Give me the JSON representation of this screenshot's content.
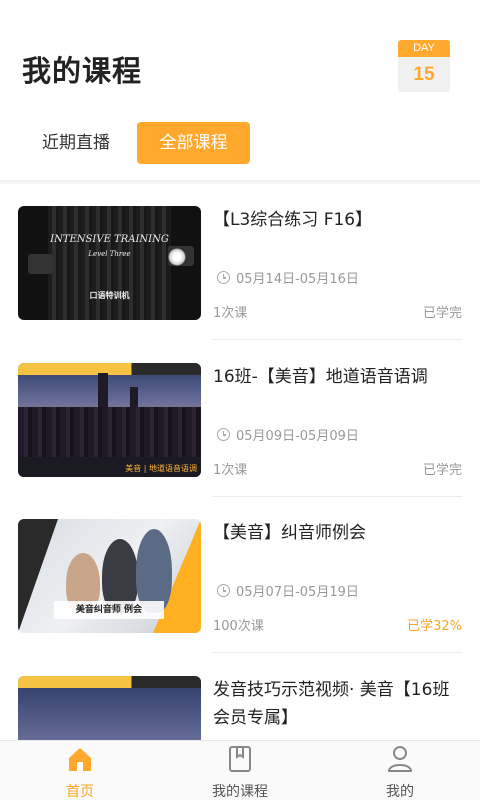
{
  "header": {
    "title": "我的课程",
    "day_label": "DAY",
    "day_number": "15"
  },
  "tabs": [
    {
      "label": "近期直播",
      "active": false
    },
    {
      "label": "全部课程",
      "active": true
    }
  ],
  "courses": [
    {
      "title": "【L3综合练习 F16】",
      "date": "05月14日-05月16日",
      "count": "1次课",
      "status": "已学完",
      "thumb_text": [
        "INTENSIVE TRAINING",
        "Level Three",
        "口语特训机"
      ]
    },
    {
      "title": "16班-【美音】地道语音语调",
      "date": "05月09日-05月09日",
      "count": "1次课",
      "status": "已学完",
      "thumb_text": [
        "美音 | 地道语音语调"
      ]
    },
    {
      "title": "【美音】纠音师例会",
      "date": "05月07日-05月19日",
      "count": "100次课",
      "status": "已学32%",
      "thumb_text": [
        "美音纠音师 例会"
      ]
    },
    {
      "title": "发音技巧示范视频· 美音【16班会员专属】",
      "date": "",
      "count": "",
      "status": ""
    }
  ],
  "bottom_nav": [
    {
      "label": "首页",
      "icon": "home-icon",
      "active": true
    },
    {
      "label": "我的课程",
      "icon": "book-icon",
      "active": false
    },
    {
      "label": "我的",
      "icon": "user-icon",
      "active": false
    }
  ],
  "colors": {
    "accent": "#ffa82c",
    "text_muted": "#999999",
    "progress": "#f5a623"
  }
}
